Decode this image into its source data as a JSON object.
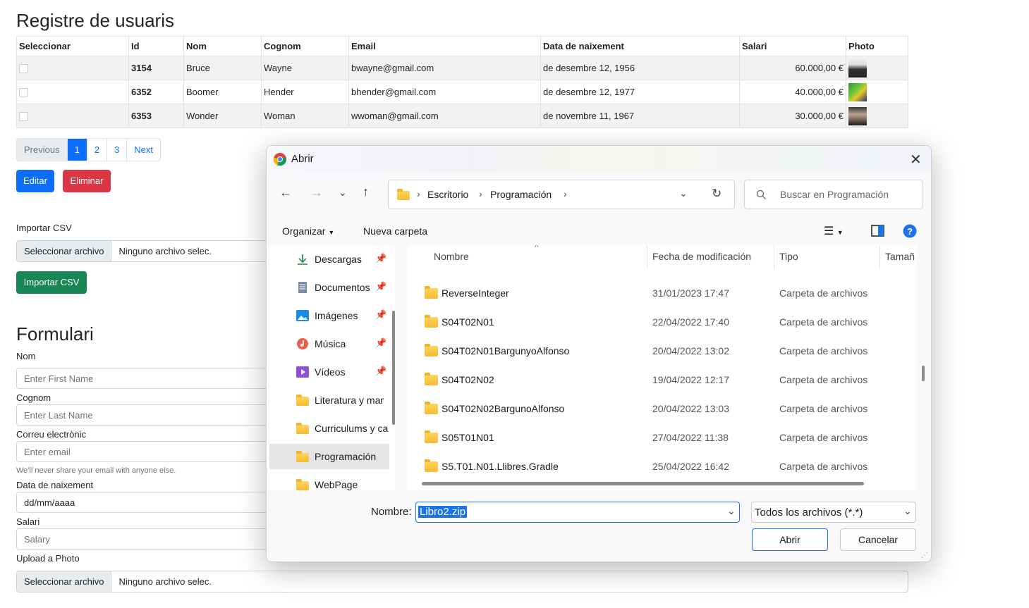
{
  "page": {
    "title": "Registre de usuaris",
    "table": {
      "headers": [
        "Seleccionar",
        "Id",
        "Nom",
        "Cognom",
        "Email",
        "Data de naixement",
        "Salari",
        "Photo"
      ],
      "rows": [
        {
          "id": "3154",
          "nom": "Bruce",
          "cognom": "Wayne",
          "email": "bwayne@gmail.com",
          "data": "de desembre 12, 1956",
          "salari": "60.000,00 €"
        },
        {
          "id": "6352",
          "nom": "Boomer",
          "cognom": "Hender",
          "email": "bhender@gmail.com",
          "data": "de desembre 12, 1977",
          "salari": "40.000,00 €"
        },
        {
          "id": "6353",
          "nom": "Wonder",
          "cognom": "Woman",
          "email": "wwoman@gmail.com",
          "data": "de novembre 11, 1967",
          "salari": "30.000,00 €"
        }
      ]
    },
    "pagination": {
      "previous": "Previous",
      "pages": [
        "1",
        "2",
        "3"
      ],
      "active": "1",
      "next": "Next"
    },
    "buttons": {
      "edit": "Editar",
      "delete": "Eliminar",
      "import": "Importar CSV"
    },
    "import_csv": {
      "label": "Importar CSV",
      "file_button": "Seleccionar archivo",
      "file_text": "Ninguno archivo selec."
    },
    "form": {
      "title": "Formulari",
      "nom_label": "Nom",
      "nom_placeholder": "Enter First Name",
      "cognom_label": "Cognom",
      "cognom_placeholder": "Enter Last Name",
      "email_label": "Correu electrònic",
      "email_placeholder": "Enter email",
      "email_help": "We'll never share your email with anyone else.",
      "date_label": "Data de naixement",
      "date_placeholder": "dd/mm/aaaa",
      "salary_label": "Salari",
      "salary_placeholder": "Salary",
      "photo_label": "Upload a Photo",
      "photo_file_button": "Seleccionar archivo",
      "photo_file_text": "Ninguno archivo selec."
    }
  },
  "dialog": {
    "title": "Abrir",
    "breadcrumb": [
      "Escritorio",
      "Programación"
    ],
    "search_placeholder": "Buscar en Programación",
    "toolbar": {
      "organize": "Organizar",
      "new_folder": "Nueva carpeta"
    },
    "nav_items": [
      {
        "label": "Descargas",
        "icon": "download-icon",
        "pinned": true
      },
      {
        "label": "Documentos",
        "icon": "document-icon",
        "pinned": true
      },
      {
        "label": "Imágenes",
        "icon": "image-icon",
        "pinned": true
      },
      {
        "label": "Música",
        "icon": "music-icon",
        "pinned": true
      },
      {
        "label": "Vídeos",
        "icon": "video-icon",
        "pinned": true
      },
      {
        "label": "Literatura y mar",
        "icon": "folder-icon",
        "pinned": false
      },
      {
        "label": "Curriculums y ca",
        "icon": "folder-icon",
        "pinned": false
      },
      {
        "label": "Programación",
        "icon": "folder-icon",
        "pinned": false,
        "selected": true
      },
      {
        "label": "WebPage",
        "icon": "folder-icon",
        "pinned": false
      }
    ],
    "columns": {
      "name": "Nombre",
      "date": "Fecha de modificación",
      "type": "Tipo",
      "size": "Tamañ"
    },
    "files": [
      {
        "name": "ReverseInteger",
        "date": "31/01/2023 17:47",
        "type": "Carpeta de archivos"
      },
      {
        "name": "S04T02N01",
        "date": "22/04/2022 17:40",
        "type": "Carpeta de archivos"
      },
      {
        "name": "S04T02N01BargunyoAlfonso",
        "date": "20/04/2022 13:02",
        "type": "Carpeta de archivos"
      },
      {
        "name": "S04T02N02",
        "date": "19/04/2022 12:17",
        "type": "Carpeta de archivos"
      },
      {
        "name": "S04T02N02BargunoAlfonso",
        "date": "20/04/2022 13:03",
        "type": "Carpeta de archivos"
      },
      {
        "name": "S05T01N01",
        "date": "27/04/2022 11:38",
        "type": "Carpeta de archivos"
      },
      {
        "name": "S5.T01.N01.Llibres.Gradle",
        "date": "25/04/2022 16:42",
        "type": "Carpeta de archivos"
      }
    ],
    "filename_label": "Nombre:",
    "filename_value": "Libro2.zip",
    "filter_value": "Todos los archivos (*.*)",
    "open_button": "Abrir",
    "cancel_button": "Cancelar"
  }
}
